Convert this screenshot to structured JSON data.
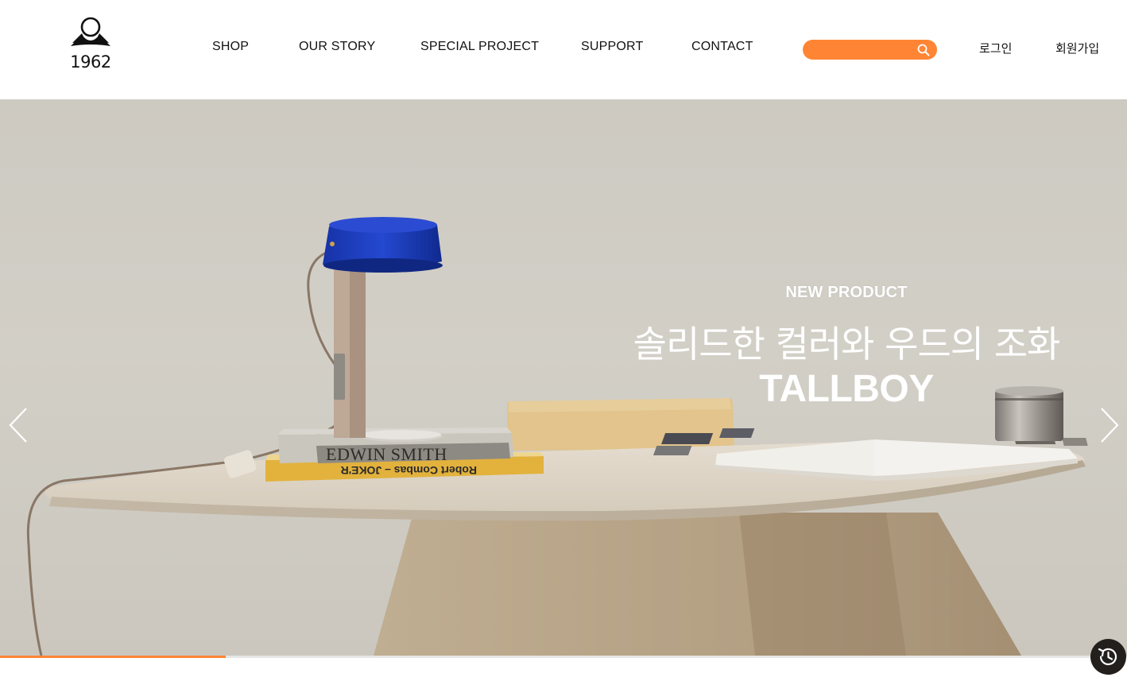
{
  "logo": {
    "text": "1962"
  },
  "nav": {
    "items": [
      {
        "label": "SHOP"
      },
      {
        "label": "OUR STORY"
      },
      {
        "label": "SPECIAL PROJECT"
      },
      {
        "label": "SUPPORT"
      },
      {
        "label": "CONTACT"
      }
    ]
  },
  "search": {
    "value": "",
    "placeholder": "",
    "icon": "search-icon"
  },
  "auth": {
    "login_label": "로그인",
    "join_label": "회원가입"
  },
  "hero": {
    "eyebrow": "NEW PRODUCT",
    "title": "솔리드한 컬러와 우드의 조화",
    "product": "TALLBOY",
    "books": {
      "top_spine": "EDWIN SMITH",
      "bottom_spine": "Robert Combas – JOKE'R"
    },
    "prev_icon": "chevron-left-icon",
    "next_icon": "chevron-right-icon"
  },
  "slider": {
    "progress": 0.2
  },
  "colors": {
    "accent": "#ff8534",
    "lamp_shade": "#1b3bb3",
    "dark": "#231f1c"
  },
  "recent_icon": "history-icon"
}
